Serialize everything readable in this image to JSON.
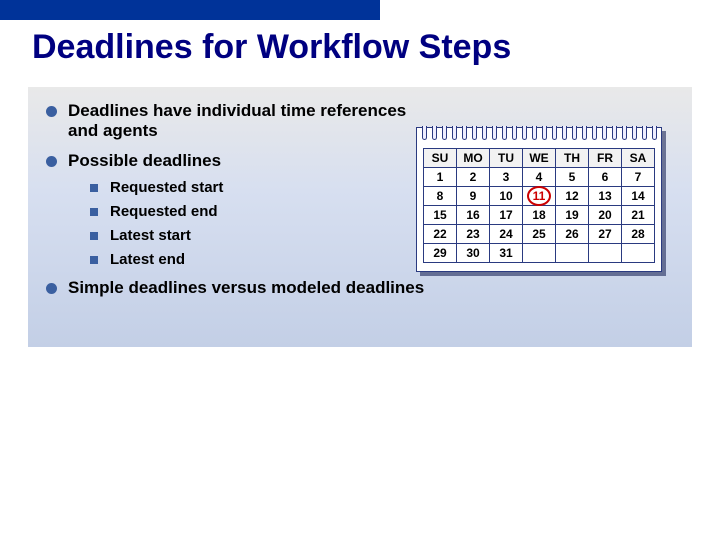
{
  "title": "Deadlines for Workflow Steps",
  "bullets": {
    "b1": "Deadlines have individual time references and agents",
    "b2": "Possible deadlines",
    "sub": {
      "s1": "Requested start",
      "s2": "Requested end",
      "s3": "Latest start",
      "s4": "Latest end"
    },
    "b3": "Simple deadlines versus modeled deadlines"
  },
  "calendar": {
    "headers": [
      "SU",
      "MO",
      "TU",
      "WE",
      "TH",
      "FR",
      "SA"
    ],
    "rows": [
      [
        "1",
        "2",
        "3",
        "4",
        "5",
        "6",
        "7"
      ],
      [
        "8",
        "9",
        "10",
        "11",
        "12",
        "13",
        "14"
      ],
      [
        "15",
        "16",
        "17",
        "18",
        "19",
        "20",
        "21"
      ],
      [
        "22",
        "23",
        "24",
        "25",
        "26",
        "27",
        "28"
      ],
      [
        "29",
        "30",
        "31",
        "",
        "",
        "",
        ""
      ]
    ],
    "circled": "11"
  }
}
